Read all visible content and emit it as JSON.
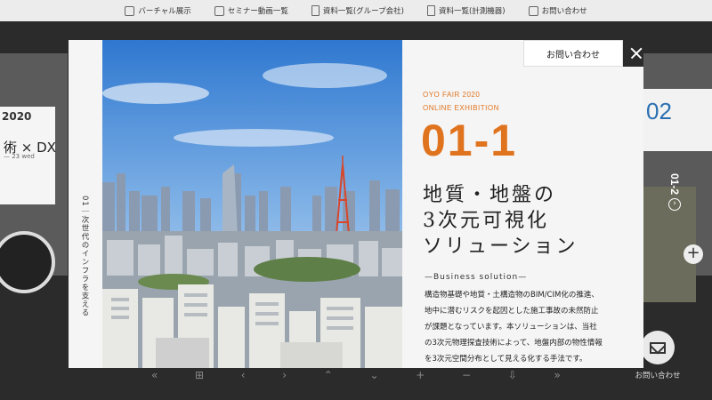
{
  "topnav": {
    "items": [
      {
        "icon": "tv-icon",
        "label": "バーチャル展示"
      },
      {
        "icon": "video-icon",
        "label": "セミナー動画一覧"
      },
      {
        "icon": "document-icon",
        "label": "資料一覧(グループ会社)"
      },
      {
        "icon": "document-icon",
        "label": "資料一覧(計測機器)"
      },
      {
        "icon": "edit-icon",
        "label": "お問い合わせ"
      }
    ]
  },
  "background": {
    "left_title": "2020",
    "left_sub": "術 × DX",
    "left_date": "— 23 wed",
    "right_num": "02",
    "plus": "+"
  },
  "modal": {
    "vertical_caption": "01｜次世代のインフラを支える",
    "fair_line1": "OYO FAIR 2020",
    "fair_line2": "ONLINE EXHIBITION",
    "number": "01-1",
    "title_lines": [
      "地質・地盤の",
      "3次元可視化",
      "ソリューション"
    ],
    "subhead": "—Business solution—",
    "body": "構造物基礎や地質・土構造物のBIM/CIM化の推進、地中に潜むリスクを起因とした施工事故の未然防止が課題となっています。本ソリューションは、当社の3次元物理探査技術によって、地盤内部の物性情報を3次元空間分布として見える化する手法です。",
    "contact_label": "お問い合わせ",
    "next_label": "01-2",
    "next_arrow": "›"
  },
  "bottom": {
    "contact_label": "お問い合わせ"
  },
  "toolbar": {
    "items": [
      "«",
      "⊞",
      "‹",
      "›",
      "⌃",
      "⌄",
      "+",
      "−",
      "⇩",
      "»"
    ]
  },
  "colors": {
    "accent": "#e0731e",
    "dark": "#2b2b2b"
  }
}
